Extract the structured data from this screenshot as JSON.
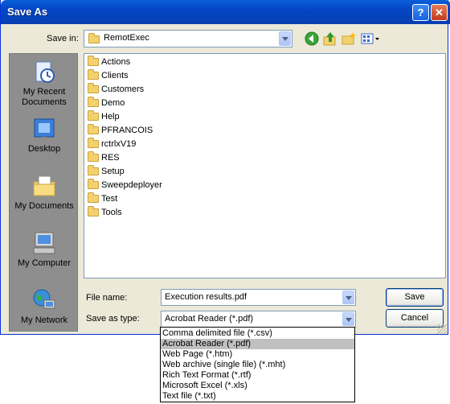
{
  "dialog": {
    "title": "Save As"
  },
  "titlebar": {
    "help_glyph": "?",
    "close_glyph": "✕"
  },
  "toolbar": {
    "save_in_label": "Save in:",
    "save_in_value": "RemotExec",
    "icons": [
      "back-icon",
      "up-folder-icon",
      "new-folder-icon",
      "views-menu-icon"
    ]
  },
  "places": [
    {
      "label": "My Recent Documents",
      "icon": "recent-documents-icon"
    },
    {
      "label": "Desktop",
      "icon": "desktop-icon"
    },
    {
      "label": "My Documents",
      "icon": "my-documents-icon"
    },
    {
      "label": "My Computer",
      "icon": "my-computer-icon"
    },
    {
      "label": "My Network",
      "icon": "my-network-icon"
    }
  ],
  "files": [
    "Actions",
    "Clients",
    "Customers",
    "Demo",
    "Help",
    "PFRANCOIS",
    "rctrlxV19",
    "RES",
    "Setup",
    "Sweepdeployer",
    "Test",
    "Tools"
  ],
  "form": {
    "file_name_label": "File name:",
    "file_name_value": "Execution results.pdf",
    "save_as_type_label": "Save as type:",
    "save_as_type_value": "Acrobat Reader (*.pdf)"
  },
  "buttons": {
    "save": "Save",
    "cancel": "Cancel"
  },
  "type_options": [
    "Comma delimited file (*.csv)",
    "Acrobat Reader (*.pdf)",
    "Web Page (*.htm)",
    "Web archive (single file) (*.mht)",
    "Rich Text Format (*.rtf)",
    "Microsoft Excel (*.xls)",
    "Text file (*.txt)"
  ],
  "selected_type_index": 1,
  "colors": {
    "title_bar": "#0545c4",
    "dialog_bg": "#ece9d8",
    "places_bar": "#8e8e8e",
    "selection": "#c0c0c0"
  }
}
